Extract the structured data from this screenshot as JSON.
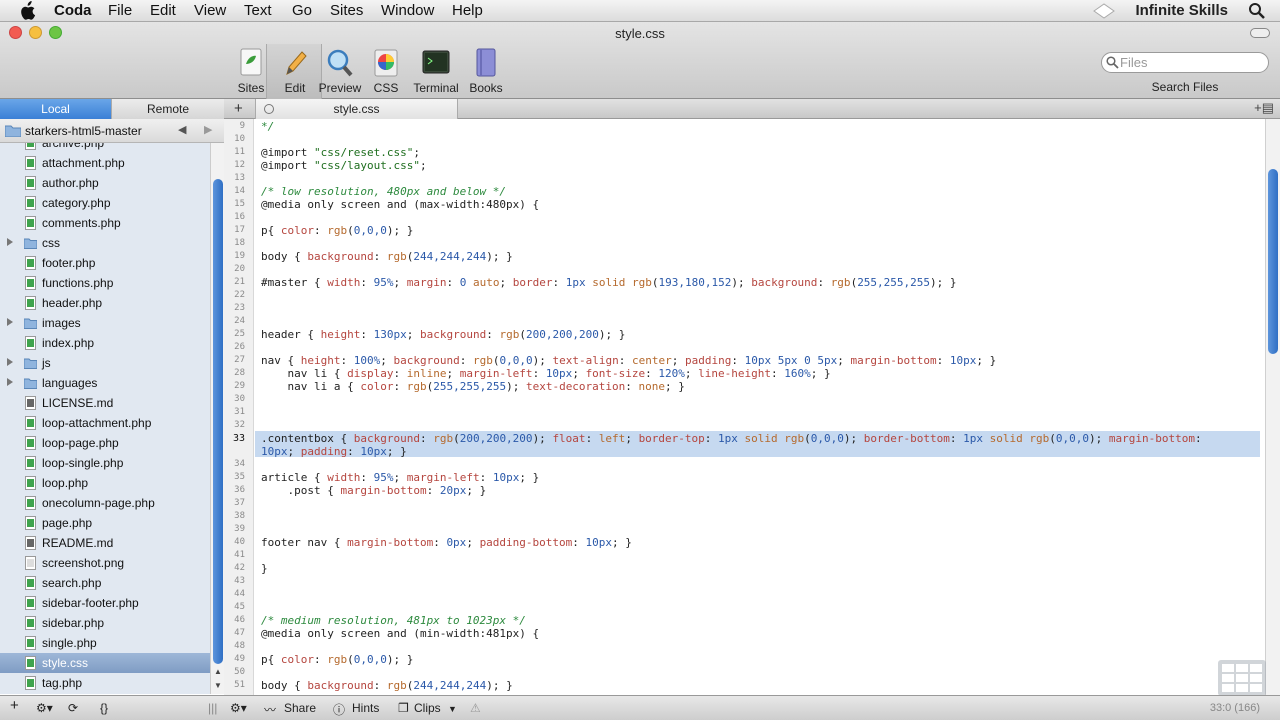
{
  "menubar": {
    "items": [
      "Coda",
      "File",
      "Edit",
      "View",
      "Text",
      "Go",
      "Sites",
      "Window",
      "Help"
    ],
    "brand": "Infinite Skills",
    "icons": [
      "apple-icon",
      "brand-diamond-icon",
      "spotlight-icon"
    ]
  },
  "window": {
    "title": "style.css"
  },
  "toolbar": {
    "buttons": [
      {
        "label": "Sites",
        "icon": "sites-icon"
      },
      {
        "label": "Edit",
        "icon": "pencil-icon"
      },
      {
        "label": "Preview",
        "icon": "magnifier-icon"
      },
      {
        "label": "CSS",
        "icon": "color-wheel-icon"
      },
      {
        "label": "Terminal",
        "icon": "terminal-icon"
      },
      {
        "label": "Books",
        "icon": "book-icon"
      }
    ],
    "search_placeholder": "Files",
    "search_label": "Search Files"
  },
  "sidebar": {
    "tabs": {
      "local": "Local",
      "remote": "Remote"
    },
    "site": "starkers-html5-master",
    "files": [
      {
        "name": "archive.php",
        "type": "php"
      },
      {
        "name": "attachment.php",
        "type": "php"
      },
      {
        "name": "author.php",
        "type": "php"
      },
      {
        "name": "category.php",
        "type": "php"
      },
      {
        "name": "comments.php",
        "type": "php"
      },
      {
        "name": "css",
        "type": "folder"
      },
      {
        "name": "footer.php",
        "type": "php"
      },
      {
        "name": "functions.php",
        "type": "php"
      },
      {
        "name": "header.php",
        "type": "php"
      },
      {
        "name": "images",
        "type": "folder"
      },
      {
        "name": "index.php",
        "type": "php"
      },
      {
        "name": "js",
        "type": "folder"
      },
      {
        "name": "languages",
        "type": "folder"
      },
      {
        "name": "LICENSE.md",
        "type": "md"
      },
      {
        "name": "loop-attachment.php",
        "type": "php"
      },
      {
        "name": "loop-page.php",
        "type": "php"
      },
      {
        "name": "loop-single.php",
        "type": "php"
      },
      {
        "name": "loop.php",
        "type": "php"
      },
      {
        "name": "onecolumn-page.php",
        "type": "php"
      },
      {
        "name": "page.php",
        "type": "php"
      },
      {
        "name": "README.md",
        "type": "md"
      },
      {
        "name": "screenshot.png",
        "type": "png"
      },
      {
        "name": "search.php",
        "type": "php"
      },
      {
        "name": "sidebar-footer.php",
        "type": "php"
      },
      {
        "name": "sidebar.php",
        "type": "php"
      },
      {
        "name": "single.php",
        "type": "php"
      },
      {
        "name": "style.css",
        "type": "css",
        "selected": true
      },
      {
        "name": "tag.php",
        "type": "php"
      }
    ]
  },
  "editor": {
    "tab": "style.css",
    "lines": [
      {
        "n": "9",
        "t": [
          [
            "cm",
            "*/"
          ]
        ]
      },
      {
        "n": "10",
        "t": []
      },
      {
        "n": "11",
        "t": [
          [
            "",
            "@import "
          ],
          [
            "st",
            "\"css/reset.css\""
          ],
          [
            "",
            ";"
          ]
        ]
      },
      {
        "n": "12",
        "t": [
          [
            "",
            "@import "
          ],
          [
            "st",
            "\"css/layout.css\""
          ],
          [
            "",
            ";"
          ]
        ]
      },
      {
        "n": "13",
        "t": []
      },
      {
        "n": "14",
        "t": [
          [
            "cm",
            "/* low resolution, 480px and below */"
          ]
        ]
      },
      {
        "n": "15",
        "t": [
          [
            "",
            "@media only screen and (max-width:480px) {"
          ]
        ]
      },
      {
        "n": "16",
        "t": []
      },
      {
        "n": "17",
        "t": [
          [
            "",
            "p{ "
          ],
          [
            "pr",
            "color"
          ],
          [
            "",
            ": "
          ],
          [
            "vl",
            "rgb"
          ],
          [
            "",
            "("
          ],
          [
            "nu",
            "0,0,0"
          ],
          [
            "",
            "); }"
          ]
        ]
      },
      {
        "n": "18",
        "t": []
      },
      {
        "n": "19",
        "t": [
          [
            "",
            "body { "
          ],
          [
            "pr",
            "background"
          ],
          [
            "",
            ": "
          ],
          [
            "vl",
            "rgb"
          ],
          [
            "",
            "("
          ],
          [
            "nu",
            "244,244,244"
          ],
          [
            "",
            "); }"
          ]
        ]
      },
      {
        "n": "20",
        "t": []
      },
      {
        "n": "21",
        "t": [
          [
            "",
            "#master { "
          ],
          [
            "pr",
            "width"
          ],
          [
            "",
            ": "
          ],
          [
            "nu",
            "95%"
          ],
          [
            "",
            "; "
          ],
          [
            "pr",
            "margin"
          ],
          [
            "",
            ": "
          ],
          [
            "nu",
            "0"
          ],
          [
            "vl",
            " auto"
          ],
          [
            "",
            "; "
          ],
          [
            "pr",
            "border"
          ],
          [
            "",
            ": "
          ],
          [
            "nu",
            "1px"
          ],
          [
            "vl",
            " solid rgb"
          ],
          [
            "",
            "("
          ],
          [
            "nu",
            "193,180,152"
          ],
          [
            "",
            "); "
          ],
          [
            "pr",
            "background"
          ],
          [
            "",
            ": "
          ],
          [
            "vl",
            "rgb"
          ],
          [
            "",
            "("
          ],
          [
            "nu",
            "255,255,255"
          ],
          [
            "",
            "); }"
          ]
        ]
      },
      {
        "n": "22",
        "t": []
      },
      {
        "n": "23",
        "t": []
      },
      {
        "n": "24",
        "t": []
      },
      {
        "n": "25",
        "t": [
          [
            "",
            "header { "
          ],
          [
            "pr",
            "height"
          ],
          [
            "",
            ": "
          ],
          [
            "nu",
            "130px"
          ],
          [
            "",
            "; "
          ],
          [
            "pr",
            "background"
          ],
          [
            "",
            ": "
          ],
          [
            "vl",
            "rgb"
          ],
          [
            "",
            "("
          ],
          [
            "nu",
            "200,200,200"
          ],
          [
            "",
            "); }"
          ]
        ]
      },
      {
        "n": "26",
        "t": []
      },
      {
        "n": "27",
        "t": [
          [
            "",
            "nav { "
          ],
          [
            "pr",
            "height"
          ],
          [
            "",
            ": "
          ],
          [
            "nu",
            "100%"
          ],
          [
            "",
            "; "
          ],
          [
            "pr",
            "background"
          ],
          [
            "",
            ": "
          ],
          [
            "vl",
            "rgb"
          ],
          [
            "",
            "("
          ],
          [
            "nu",
            "0,0,0"
          ],
          [
            "",
            "); "
          ],
          [
            "pr",
            "text-align"
          ],
          [
            "",
            ": "
          ],
          [
            "vl",
            "center"
          ],
          [
            "",
            "; "
          ],
          [
            "pr",
            "padding"
          ],
          [
            "",
            ": "
          ],
          [
            "nu",
            "10px 5px 0 5px"
          ],
          [
            "",
            "; "
          ],
          [
            "pr",
            "margin-bottom"
          ],
          [
            "",
            ": "
          ],
          [
            "nu",
            "10px"
          ],
          [
            "",
            "; }"
          ]
        ]
      },
      {
        "n": "28",
        "t": [
          [
            "",
            "    nav li { "
          ],
          [
            "pr",
            "display"
          ],
          [
            "",
            ": "
          ],
          [
            "vl",
            "inline"
          ],
          [
            "",
            "; "
          ],
          [
            "pr",
            "margin-left"
          ],
          [
            "",
            ": "
          ],
          [
            "nu",
            "10px"
          ],
          [
            "",
            "; "
          ],
          [
            "pr",
            "font-size"
          ],
          [
            "",
            ": "
          ],
          [
            "nu",
            "120%"
          ],
          [
            "",
            "; "
          ],
          [
            "pr",
            "line-height"
          ],
          [
            "",
            ": "
          ],
          [
            "nu",
            "160%"
          ],
          [
            "",
            "; }"
          ]
        ]
      },
      {
        "n": "29",
        "t": [
          [
            "",
            "    nav li a { "
          ],
          [
            "pr",
            "color"
          ],
          [
            "",
            ": "
          ],
          [
            "vl",
            "rgb"
          ],
          [
            "",
            "("
          ],
          [
            "nu",
            "255,255,255"
          ],
          [
            "",
            "); "
          ],
          [
            "pr",
            "text-decoration"
          ],
          [
            "",
            ": "
          ],
          [
            "vl",
            "none"
          ],
          [
            "",
            "; }"
          ]
        ]
      },
      {
        "n": "30",
        "t": []
      },
      {
        "n": "31",
        "t": []
      },
      {
        "n": "32",
        "t": []
      },
      {
        "n": "33",
        "cur": true,
        "t": [
          [
            "",
            ".contentbox { "
          ],
          [
            "pr",
            "background"
          ],
          [
            "",
            ": "
          ],
          [
            "vl",
            "rgb"
          ],
          [
            "",
            "("
          ],
          [
            "nu",
            "200,200,200"
          ],
          [
            "",
            "); "
          ],
          [
            "pr",
            "float"
          ],
          [
            "",
            ": "
          ],
          [
            "vl",
            "left"
          ],
          [
            "",
            "; "
          ],
          [
            "pr",
            "border-top"
          ],
          [
            "",
            ": "
          ],
          [
            "nu",
            "1px"
          ],
          [
            "vl",
            " solid rgb"
          ],
          [
            "",
            "("
          ],
          [
            "nu",
            "0,0,0"
          ],
          [
            "",
            "); "
          ],
          [
            "pr",
            "border-bottom"
          ],
          [
            "",
            ": "
          ],
          [
            "nu",
            "1px"
          ],
          [
            "vl",
            " solid rgb"
          ],
          [
            "",
            "("
          ],
          [
            "nu",
            "0,0,0"
          ],
          [
            "",
            "); "
          ],
          [
            "pr",
            "margin-bottom"
          ],
          [
            "",
            ":"
          ]
        ]
      },
      {
        "n": "",
        "t": [
          [
            "nu",
            "10px"
          ],
          [
            "",
            "; "
          ],
          [
            "pr",
            "padding"
          ],
          [
            "",
            ": "
          ],
          [
            "nu",
            "10px"
          ],
          [
            "",
            "; }"
          ]
        ]
      },
      {
        "n": "34",
        "t": []
      },
      {
        "n": "35",
        "t": [
          [
            "",
            "article { "
          ],
          [
            "pr",
            "width"
          ],
          [
            "",
            ": "
          ],
          [
            "nu",
            "95%"
          ],
          [
            "",
            "; "
          ],
          [
            "pr",
            "margin-left"
          ],
          [
            "",
            ": "
          ],
          [
            "nu",
            "10px"
          ],
          [
            "",
            "; }"
          ]
        ]
      },
      {
        "n": "36",
        "t": [
          [
            "",
            "    .post { "
          ],
          [
            "pr",
            "margin-bottom"
          ],
          [
            "",
            ": "
          ],
          [
            "nu",
            "20px"
          ],
          [
            "",
            "; }"
          ]
        ]
      },
      {
        "n": "37",
        "t": []
      },
      {
        "n": "38",
        "t": []
      },
      {
        "n": "39",
        "t": []
      },
      {
        "n": "40",
        "t": [
          [
            "",
            "footer nav { "
          ],
          [
            "pr",
            "margin-bottom"
          ],
          [
            "",
            ": "
          ],
          [
            "nu",
            "0px"
          ],
          [
            "",
            "; "
          ],
          [
            "pr",
            "padding-bottom"
          ],
          [
            "",
            ": "
          ],
          [
            "nu",
            "10px"
          ],
          [
            "",
            "; }"
          ]
        ]
      },
      {
        "n": "41",
        "t": []
      },
      {
        "n": "42",
        "t": [
          [
            "",
            "}"
          ]
        ]
      },
      {
        "n": "43",
        "t": []
      },
      {
        "n": "44",
        "t": []
      },
      {
        "n": "45",
        "t": []
      },
      {
        "n": "46",
        "t": [
          [
            "cm",
            "/* medium resolution, 481px to 1023px */"
          ]
        ]
      },
      {
        "n": "47",
        "t": [
          [
            "",
            "@media only screen and (min-width:481px) {"
          ]
        ]
      },
      {
        "n": "48",
        "t": []
      },
      {
        "n": "49",
        "t": [
          [
            "",
            "p{ "
          ],
          [
            "pr",
            "color"
          ],
          [
            "",
            ": "
          ],
          [
            "vl",
            "rgb"
          ],
          [
            "",
            "("
          ],
          [
            "nu",
            "0,0,0"
          ],
          [
            "",
            "); }"
          ]
        ]
      },
      {
        "n": "50",
        "t": []
      },
      {
        "n": "51",
        "t": [
          [
            "",
            "body { "
          ],
          [
            "pr",
            "background"
          ],
          [
            "",
            ": "
          ],
          [
            "vl",
            "rgb"
          ],
          [
            "",
            "("
          ],
          [
            "nu",
            "244,244,244"
          ],
          [
            "",
            "); }"
          ]
        ]
      }
    ]
  },
  "statusbar": {
    "share": "Share",
    "hints": "Hints",
    "clips": "Clips",
    "cursor_pos": "33:0 (166)"
  }
}
